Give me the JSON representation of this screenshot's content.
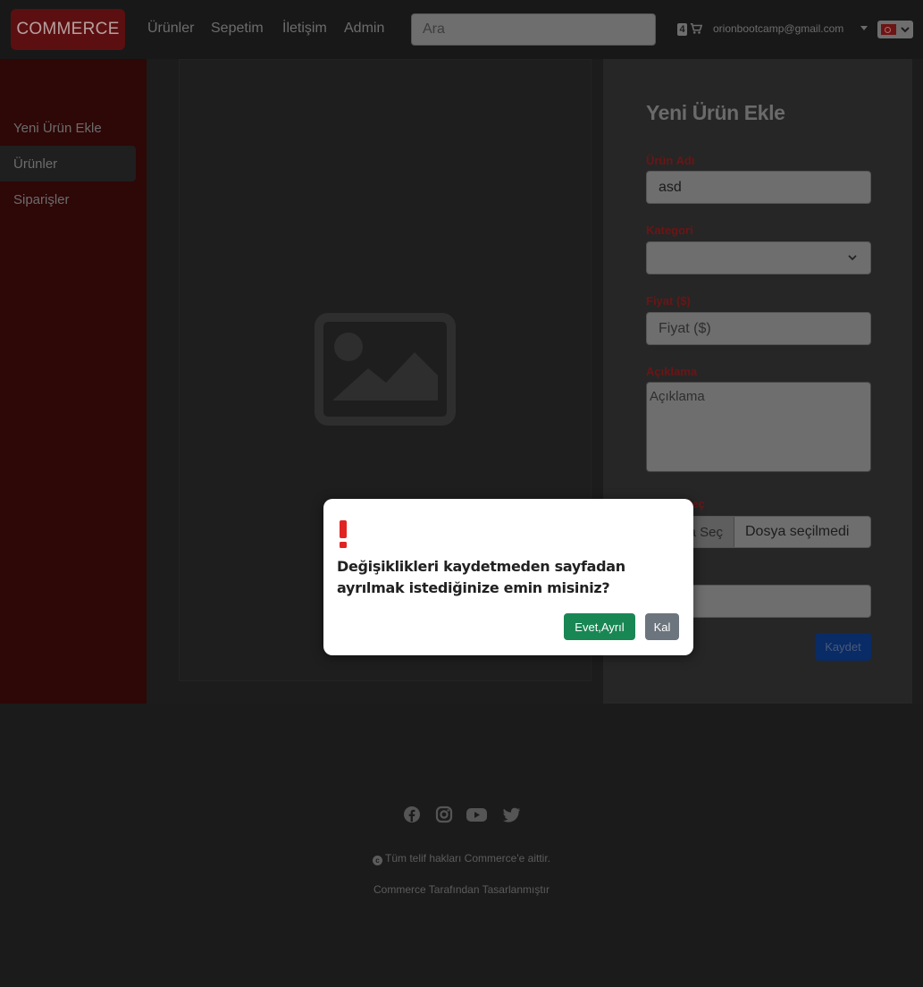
{
  "navbar": {
    "brand": "COMMERCE",
    "links": [
      "Ürünler",
      "Sepetim",
      "İletişim",
      "Admin"
    ],
    "search_placeholder": "Ara",
    "cart_count": "4",
    "user_email": "orionbootcamp@gmail.com",
    "language_flag": "turkey-flag-icon"
  },
  "sidebar": {
    "items": [
      {
        "label": "Yeni Ürün Ekle",
        "active": false
      },
      {
        "label": "Ürünler",
        "active": true
      },
      {
        "label": "Siparişler",
        "active": false
      }
    ]
  },
  "form": {
    "title": "Yeni Ürün Ekle",
    "name_label": "Ürün Adı",
    "name_value": "asd",
    "category_label": "Kategori",
    "category_value": "",
    "price_label": "Fiyat ($)",
    "price_placeholder": "Fiyat ($)",
    "description_label": "Açıklama",
    "description_placeholder": "Açıklama",
    "image_label": "Resim Seç",
    "file_button": "Dosya Seç",
    "file_status": "Dosya seçilmedi",
    "save_button": "Kaydet"
  },
  "modal": {
    "icon": "exclamation-icon",
    "message": "Değişiklikleri kaydetmeden sayfadan ayrılmak istediğinize emin misiniz?",
    "confirm_button": "Evet,Ayrıl",
    "cancel_button": "Kal",
    "colors": {
      "confirm": "#198754",
      "cancel": "#6c757d",
      "icon": "#e02424"
    }
  },
  "footer": {
    "social_icons": [
      "facebook-icon",
      "instagram-icon",
      "youtube-icon",
      "twitter-icon"
    ],
    "copyright": "Tüm telif hakları Commerce'e aittir.",
    "designer": "Commerce Tarafından Tasarlanmıştır"
  }
}
